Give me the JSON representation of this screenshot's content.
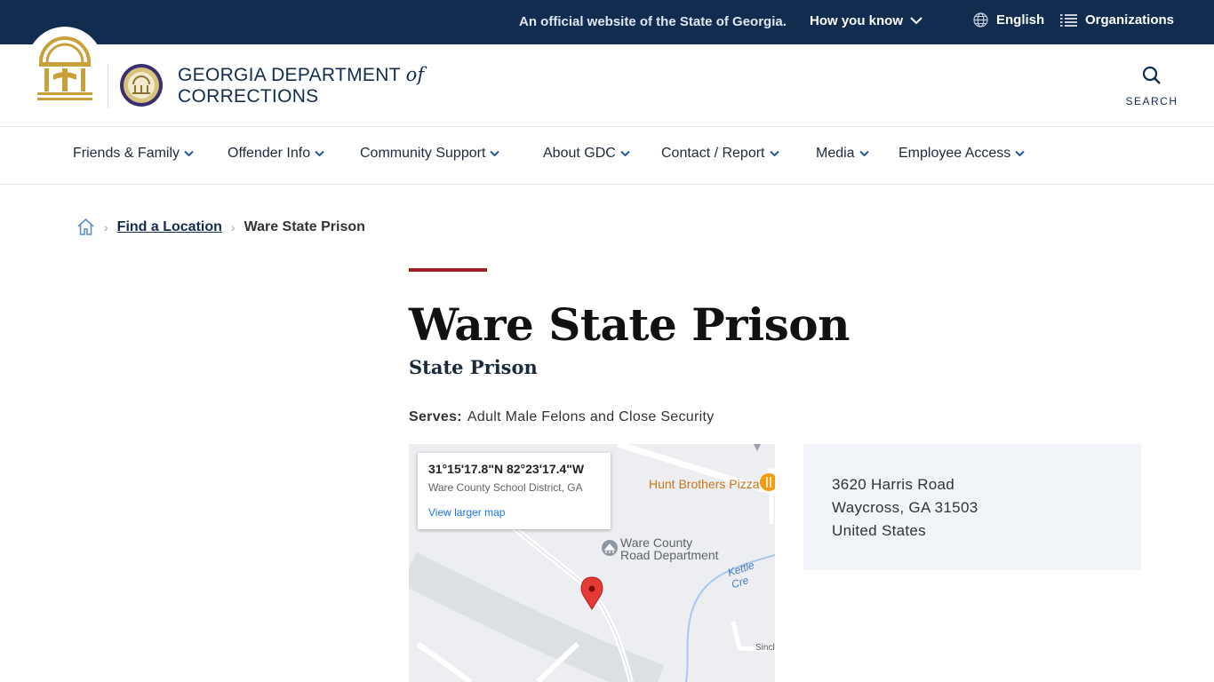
{
  "topbar": {
    "official_text": "An official website of the State of Georgia.",
    "how_you_know": "How you know",
    "language": "English",
    "organizations": "Organizations"
  },
  "header": {
    "brand_line1": "GEORGIA DEPARTMENT",
    "brand_of": "of",
    "brand_line2": "CORRECTIONS",
    "search_label": "SEARCH"
  },
  "nav": {
    "items": [
      {
        "label": "Friends & Family"
      },
      {
        "label": "Offender Info"
      },
      {
        "label": "Community Support"
      },
      {
        "label": "About GDC"
      },
      {
        "label": "Contact / Report"
      },
      {
        "label": "Media"
      },
      {
        "label": "Employee Access"
      }
    ]
  },
  "breadcrumb": {
    "link": "Find a Location",
    "current": "Ware State Prison"
  },
  "page": {
    "title": "Ware State Prison",
    "subtitle": "State Prison",
    "serves_label": "Serves:",
    "serves_value": "Adult Male Felons and Close Security"
  },
  "map": {
    "coordinates": "31°15'17.8\"N 82°23'17.4\"W",
    "district": "Ware County School District, GA",
    "larger_map": "View larger map",
    "poi_pizza": "Hunt Brothers Pizza",
    "poi_road_1": "Ware County",
    "poi_road_2": "Road Department",
    "poi_creek": "Kettle Cre",
    "poi_sinc": "Sincl"
  },
  "address": {
    "line1": "3620 Harris Road",
    "line2": "Waycross, GA 31503",
    "line3": "United States"
  },
  "colors": {
    "topbar_bg": "#122c4f",
    "accent_red": "#a11e25",
    "address_bg": "#f1f4f8",
    "gold": "#c9a13b"
  }
}
